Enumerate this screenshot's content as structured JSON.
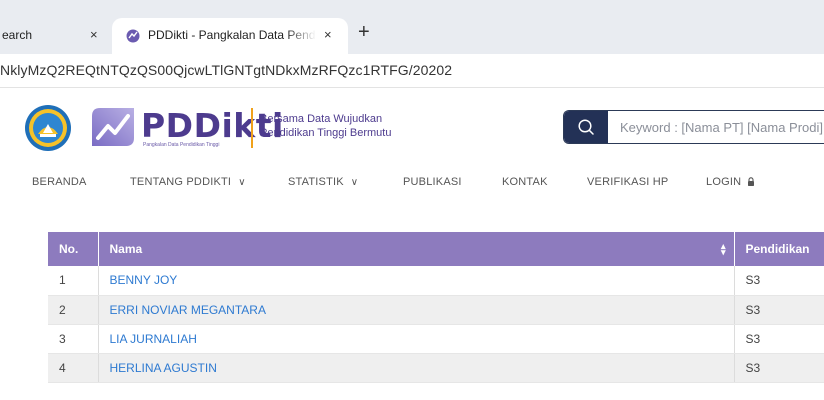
{
  "browser": {
    "tabs": [
      {
        "title": "earch",
        "close": "×"
      },
      {
        "title": "PDDikti - Pangkalan Data Pendidikan Tinggi",
        "close": "×"
      }
    ],
    "new_tab": "+",
    "address": "NklyMzQ2REQtNTQzQS00QjcwLTlGNTgtNDkxMzRFQzc1RTFG/20202"
  },
  "site": {
    "brand": "PDDikti",
    "brand_sub": "Pangkalan Data Pendidikan Tinggi",
    "tagline_line1": "Bersama Data Wujudkan",
    "tagline_line2": "Pendidikan Tinggi Bermutu",
    "search": {
      "placeholder": "Keyword : [Nama PT] [Nama Prodi]"
    },
    "colors": {
      "brand_purple": "#4d3b8e",
      "table_header": "#8d7bbe",
      "link": "#2e7ad1",
      "search_button": "#233156",
      "accent_orange": "#f0a11b"
    }
  },
  "nav": {
    "items": [
      {
        "label": "BERANDA",
        "dropdown": false
      },
      {
        "label": "TENTANG PDDIKTI",
        "dropdown": true
      },
      {
        "label": "STATISTIK",
        "dropdown": true
      },
      {
        "label": "PUBLIKASI",
        "dropdown": false
      },
      {
        "label": "KONTAK",
        "dropdown": false
      },
      {
        "label": "VERIFIKASI HP",
        "dropdown": false
      },
      {
        "label": "LOGIN",
        "dropdown": false,
        "icon": "lock-icon"
      }
    ]
  },
  "table": {
    "headers": {
      "no": "No.",
      "nama": "Nama",
      "pendidikan": "Pendidikan"
    },
    "sort_icon": "sort-icon",
    "rows": [
      {
        "no": "1",
        "nama": "BENNY JOY",
        "pendidikan": "S3"
      },
      {
        "no": "2",
        "nama": "ERRI NOVIAR MEGANTARA",
        "pendidikan": "S3"
      },
      {
        "no": "3",
        "nama": "LIA JURNALIAH",
        "pendidikan": "S3"
      },
      {
        "no": "4",
        "nama": "HERLINA AGUSTIN",
        "pendidikan": "S3"
      }
    ]
  }
}
